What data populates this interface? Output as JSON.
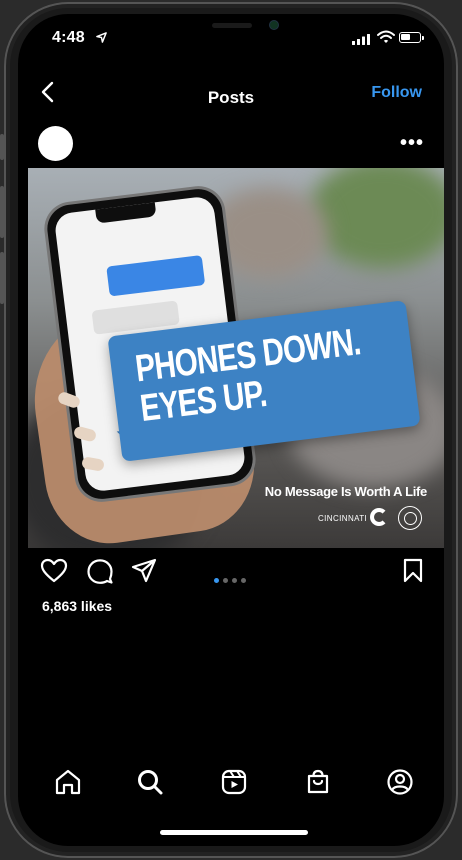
{
  "status_bar": {
    "time": "4:48"
  },
  "nav": {
    "title": "Posts",
    "follow_label": "Follow"
  },
  "post": {
    "banner_line1": "PHONES DOWN.",
    "banner_line2": "EYES UP.",
    "tagline": "No Message Is Worth A Life",
    "logo_text": "CINCINNATI",
    "likes": "6,863 likes",
    "carousel": {
      "total": 4,
      "active_index": 0
    }
  },
  "colors": {
    "accent": "#3897f0",
    "banner": "#3d82c4",
    "background": "#000000"
  },
  "icons": {
    "back": "chevron-left-icon",
    "more": "more-horizontal-icon",
    "like": "heart-icon",
    "comment": "comment-icon",
    "share": "send-icon",
    "save": "bookmark-icon",
    "tabs": [
      "home-icon",
      "search-icon",
      "reels-icon",
      "shop-icon",
      "profile-icon"
    ]
  }
}
